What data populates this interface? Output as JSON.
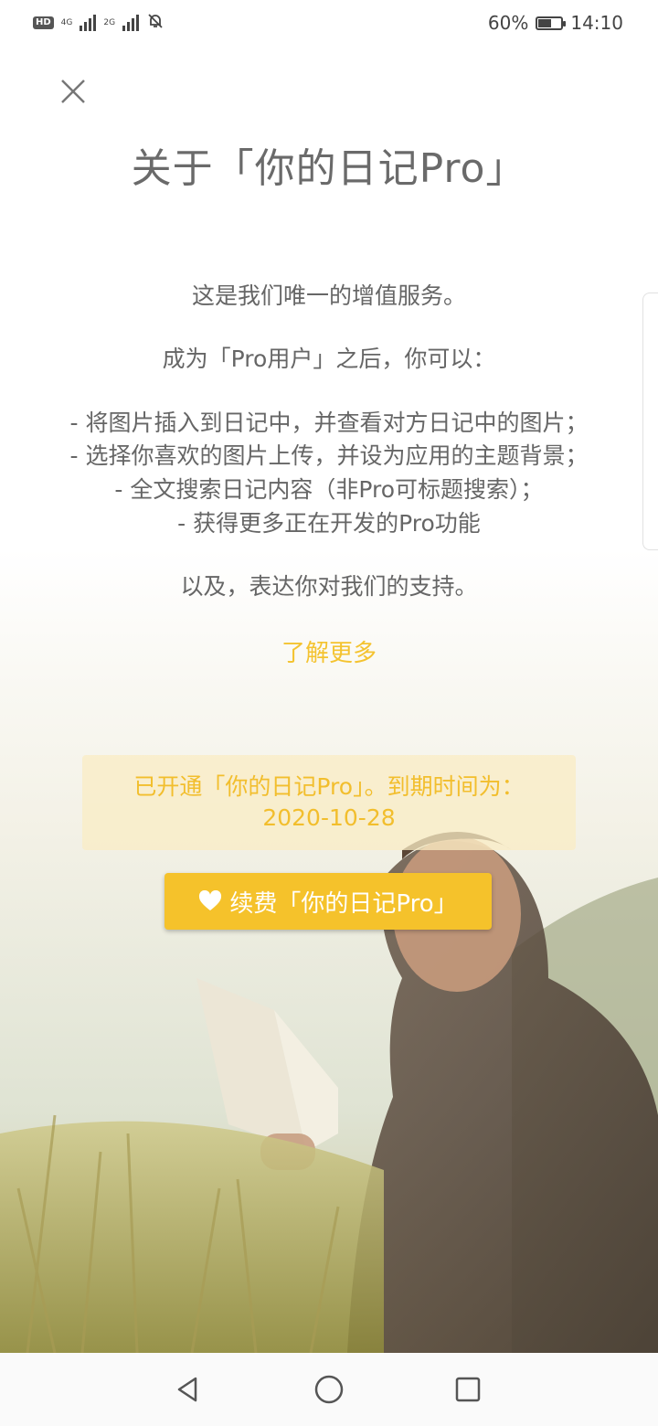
{
  "status_bar": {
    "hd_label": "HD",
    "network1": "4G",
    "network2": "2G",
    "battery_text": "60%",
    "battery_level": 0.6,
    "time": "14:10"
  },
  "page": {
    "title": "关于「你的日记Pro」"
  },
  "content": {
    "intro": "这是我们唯一的增值服务。",
    "lead": "成为「Pro用户」之后，你可以：",
    "features": [
      "- 将图片插入到日记中，并查看对方日记中的图片；",
      "- 选择你喜欢的图片上传，并设为应用的主题背景；",
      "- 全文搜索日记内容（非Pro可标题搜索）；",
      "- 获得更多正在开发的Pro功能"
    ],
    "support": "以及，表达你对我们的支持。",
    "learn_more": "了解更多"
  },
  "subscription": {
    "status_line": "已开通「你的日记Pro」。到期时间为：",
    "expiry": "2020-10-28",
    "renew_label": "续费「你的日记Pro」"
  },
  "colors": {
    "accent": "#f5c22b",
    "accent_text": "#f2be2d",
    "status_box_bg": "#faecc4",
    "text": "#666666"
  },
  "icons": {
    "close": "close-icon",
    "heart": "heart-icon",
    "back": "back-triangle-icon",
    "home": "home-circle-icon",
    "recents": "recents-square-icon"
  }
}
